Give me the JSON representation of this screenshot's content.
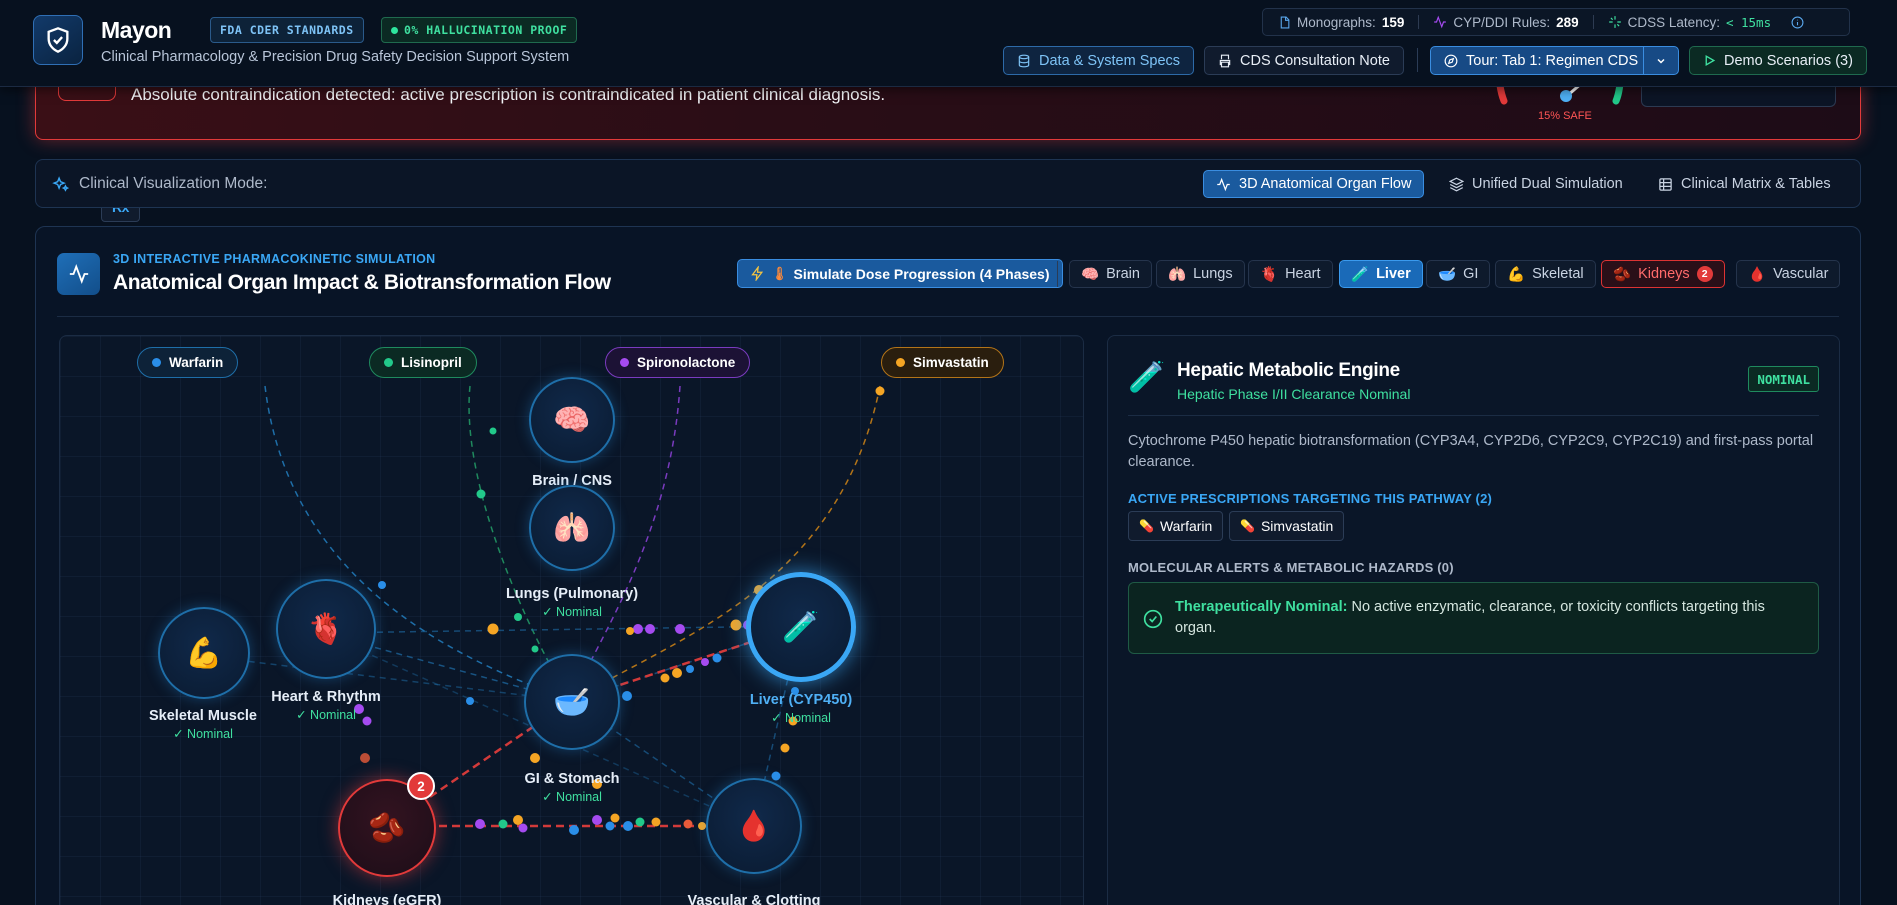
{
  "alert": {
    "message": "Absolute contraindication detected: active prescription is contraindicated in patient clinical diagnosis.",
    "gauge_label": "15% SAFE"
  },
  "header": {
    "brand_main": "Mayon",
    "brand_accent": "Rx",
    "subtitle": "Clinical Pharmacology & Precision Drug Safety Decision Support System",
    "tag_fda": "FDA CDER STANDARDS",
    "tag_hallucination": "0% HALLUCINATION PROOF",
    "stats": {
      "monographs_label": "Monographs:",
      "monographs_value": "159",
      "cyp_label": "CYP/DDI Rules:",
      "cyp_value": "289",
      "latency_label": "CDSS Latency:",
      "latency_value": "< 15ms"
    },
    "buttons": {
      "data_specs": "Data & System Specs",
      "consultation": "CDS Consultation Note",
      "tour": "Tour: Tab 1: Regimen CDS",
      "demo": "Demo Scenarios (3)"
    }
  },
  "mode_bar": {
    "label": "Clinical Visualization Mode:",
    "modes": [
      "3D Anatomical Organ Flow",
      "Unified Dual Simulation",
      "Clinical Matrix & Tables"
    ],
    "active_index": 0
  },
  "panel": {
    "kicker": "3D INTERACTIVE PHARMACOKINETIC SIMULATION",
    "title": "Anatomical Organ Impact & Biotransformation Flow",
    "simulate_button": "Simulate Dose Progression (4 Phases)",
    "organ_filters": [
      {
        "label": "Brain",
        "icon": "🧠"
      },
      {
        "label": "Lungs",
        "icon": "🫁"
      },
      {
        "label": "Heart",
        "icon": "🫀"
      },
      {
        "label": "Liver",
        "icon": "🧪"
      },
      {
        "label": "GI",
        "icon": "🥣"
      },
      {
        "label": "Skeletal",
        "icon": "💪"
      },
      {
        "label": "Kidneys",
        "icon": "🫘",
        "badge": "2"
      },
      {
        "label": "Vascular",
        "icon": "🩸"
      }
    ],
    "drugs": [
      {
        "name": "Warfarin",
        "color": "#2a8ee8"
      },
      {
        "name": "Lisinopril",
        "color": "#22c98a"
      },
      {
        "name": "Spironolactone",
        "color": "#a54bf0"
      },
      {
        "name": "Simvastatin",
        "color": "#f5a524"
      }
    ],
    "organs": {
      "brain": {
        "name": "Brain / CNS",
        "icon": "🧠"
      },
      "lungs": {
        "name": "Lungs (Pulmonary)",
        "status": "✓ Nominal",
        "icon": "🫁"
      },
      "heart": {
        "name": "Heart & Rhythm",
        "status": "✓ Nominal",
        "icon": "🫀"
      },
      "skeletal": {
        "name": "Skeletal Muscle",
        "status": "✓ Nominal",
        "icon": "💪"
      },
      "gi": {
        "name": "GI & Stomach",
        "status": "✓ Nominal",
        "icon": "🥣"
      },
      "liver": {
        "name": "Liver (CYP450)",
        "status": "✓ Nominal",
        "icon": "🧪"
      },
      "kidneys": {
        "name": "Kidneys (eGFR)",
        "badge": "2",
        "icon": "🫘"
      },
      "vascular": {
        "name": "Vascular & Clotting",
        "icon": "🩸"
      }
    }
  },
  "info": {
    "icon": "🧪",
    "title": "Hepatic Metabolic Engine",
    "subtitle": "Hepatic Phase I/II Clearance Nominal",
    "status_badge": "NOMINAL",
    "description": "Cytochrome P450 hepatic biotransformation (CYP3A4, CYP2D6, CYP2C9, CYP2C19) and first-pass portal clearance.",
    "prescriptions_header": "ACTIVE PRESCRIPTIONS TARGETING THIS PATHWAY (2)",
    "prescriptions": [
      "Warfarin",
      "Simvastatin"
    ],
    "alerts_header": "MOLECULAR ALERTS & METABOLIC HAZARDS (0)",
    "ok_title": "Therapeutically Nominal:",
    "ok_text": "No active enzymatic, clearance, or toxicity conflicts targeting this organ."
  },
  "colors": {
    "accent": "#3aa7f5",
    "success": "#3fe0a0",
    "danger": "#e23a3a",
    "background": "#07111f"
  }
}
